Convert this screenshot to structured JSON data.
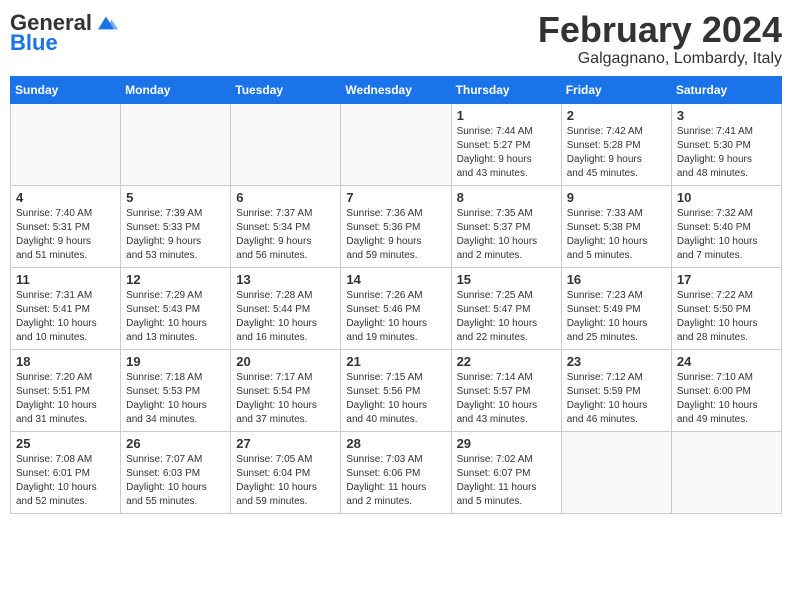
{
  "header": {
    "logo_general": "General",
    "logo_blue": "Blue",
    "month_title": "February 2024",
    "location": "Galgagnano, Lombardy, Italy"
  },
  "weekdays": [
    "Sunday",
    "Monday",
    "Tuesday",
    "Wednesday",
    "Thursday",
    "Friday",
    "Saturday"
  ],
  "weeks": [
    [
      {
        "day": "",
        "info": ""
      },
      {
        "day": "",
        "info": ""
      },
      {
        "day": "",
        "info": ""
      },
      {
        "day": "",
        "info": ""
      },
      {
        "day": "1",
        "info": "Sunrise: 7:44 AM\nSunset: 5:27 PM\nDaylight: 9 hours\nand 43 minutes."
      },
      {
        "day": "2",
        "info": "Sunrise: 7:42 AM\nSunset: 5:28 PM\nDaylight: 9 hours\nand 45 minutes."
      },
      {
        "day": "3",
        "info": "Sunrise: 7:41 AM\nSunset: 5:30 PM\nDaylight: 9 hours\nand 48 minutes."
      }
    ],
    [
      {
        "day": "4",
        "info": "Sunrise: 7:40 AM\nSunset: 5:31 PM\nDaylight: 9 hours\nand 51 minutes."
      },
      {
        "day": "5",
        "info": "Sunrise: 7:39 AM\nSunset: 5:33 PM\nDaylight: 9 hours\nand 53 minutes."
      },
      {
        "day": "6",
        "info": "Sunrise: 7:37 AM\nSunset: 5:34 PM\nDaylight: 9 hours\nand 56 minutes."
      },
      {
        "day": "7",
        "info": "Sunrise: 7:36 AM\nSunset: 5:36 PM\nDaylight: 9 hours\nand 59 minutes."
      },
      {
        "day": "8",
        "info": "Sunrise: 7:35 AM\nSunset: 5:37 PM\nDaylight: 10 hours\nand 2 minutes."
      },
      {
        "day": "9",
        "info": "Sunrise: 7:33 AM\nSunset: 5:38 PM\nDaylight: 10 hours\nand 5 minutes."
      },
      {
        "day": "10",
        "info": "Sunrise: 7:32 AM\nSunset: 5:40 PM\nDaylight: 10 hours\nand 7 minutes."
      }
    ],
    [
      {
        "day": "11",
        "info": "Sunrise: 7:31 AM\nSunset: 5:41 PM\nDaylight: 10 hours\nand 10 minutes."
      },
      {
        "day": "12",
        "info": "Sunrise: 7:29 AM\nSunset: 5:43 PM\nDaylight: 10 hours\nand 13 minutes."
      },
      {
        "day": "13",
        "info": "Sunrise: 7:28 AM\nSunset: 5:44 PM\nDaylight: 10 hours\nand 16 minutes."
      },
      {
        "day": "14",
        "info": "Sunrise: 7:26 AM\nSunset: 5:46 PM\nDaylight: 10 hours\nand 19 minutes."
      },
      {
        "day": "15",
        "info": "Sunrise: 7:25 AM\nSunset: 5:47 PM\nDaylight: 10 hours\nand 22 minutes."
      },
      {
        "day": "16",
        "info": "Sunrise: 7:23 AM\nSunset: 5:49 PM\nDaylight: 10 hours\nand 25 minutes."
      },
      {
        "day": "17",
        "info": "Sunrise: 7:22 AM\nSunset: 5:50 PM\nDaylight: 10 hours\nand 28 minutes."
      }
    ],
    [
      {
        "day": "18",
        "info": "Sunrise: 7:20 AM\nSunset: 5:51 PM\nDaylight: 10 hours\nand 31 minutes."
      },
      {
        "day": "19",
        "info": "Sunrise: 7:18 AM\nSunset: 5:53 PM\nDaylight: 10 hours\nand 34 minutes."
      },
      {
        "day": "20",
        "info": "Sunrise: 7:17 AM\nSunset: 5:54 PM\nDaylight: 10 hours\nand 37 minutes."
      },
      {
        "day": "21",
        "info": "Sunrise: 7:15 AM\nSunset: 5:56 PM\nDaylight: 10 hours\nand 40 minutes."
      },
      {
        "day": "22",
        "info": "Sunrise: 7:14 AM\nSunset: 5:57 PM\nDaylight: 10 hours\nand 43 minutes."
      },
      {
        "day": "23",
        "info": "Sunrise: 7:12 AM\nSunset: 5:59 PM\nDaylight: 10 hours\nand 46 minutes."
      },
      {
        "day": "24",
        "info": "Sunrise: 7:10 AM\nSunset: 6:00 PM\nDaylight: 10 hours\nand 49 minutes."
      }
    ],
    [
      {
        "day": "25",
        "info": "Sunrise: 7:08 AM\nSunset: 6:01 PM\nDaylight: 10 hours\nand 52 minutes."
      },
      {
        "day": "26",
        "info": "Sunrise: 7:07 AM\nSunset: 6:03 PM\nDaylight: 10 hours\nand 55 minutes."
      },
      {
        "day": "27",
        "info": "Sunrise: 7:05 AM\nSunset: 6:04 PM\nDaylight: 10 hours\nand 59 minutes."
      },
      {
        "day": "28",
        "info": "Sunrise: 7:03 AM\nSunset: 6:06 PM\nDaylight: 11 hours\nand 2 minutes."
      },
      {
        "day": "29",
        "info": "Sunrise: 7:02 AM\nSunset: 6:07 PM\nDaylight: 11 hours\nand 5 minutes."
      },
      {
        "day": "",
        "info": ""
      },
      {
        "day": "",
        "info": ""
      }
    ]
  ]
}
